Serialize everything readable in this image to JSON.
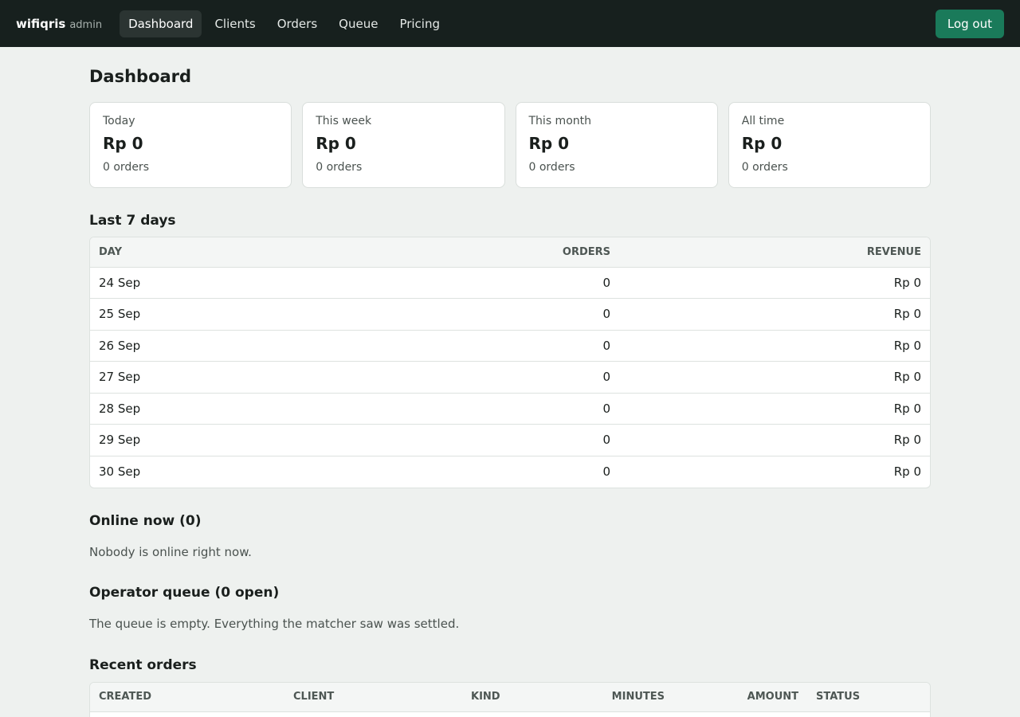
{
  "header": {
    "brand": "wifiqris",
    "role": "admin",
    "nav": [
      {
        "label": "Dashboard",
        "active": true
      },
      {
        "label": "Clients",
        "active": false
      },
      {
        "label": "Orders",
        "active": false
      },
      {
        "label": "Queue",
        "active": false
      },
      {
        "label": "Pricing",
        "active": false
      }
    ],
    "logout_label": "Log out",
    "accent_color": "#1a7a5a"
  },
  "page": {
    "title": "Dashboard"
  },
  "stats": [
    {
      "label": "Today",
      "value": "Rp 0",
      "sub": "0 orders"
    },
    {
      "label": "This week",
      "value": "Rp 0",
      "sub": "0 orders"
    },
    {
      "label": "This month",
      "value": "Rp 0",
      "sub": "0 orders"
    },
    {
      "label": "All time",
      "value": "Rp 0",
      "sub": "0 orders"
    }
  ],
  "last7": {
    "title": "Last 7 days",
    "columns": [
      "Day",
      "Orders",
      "Revenue"
    ],
    "rows": [
      {
        "day": "24 Sep",
        "orders": "0",
        "revenue": "Rp 0"
      },
      {
        "day": "25 Sep",
        "orders": "0",
        "revenue": "Rp 0"
      },
      {
        "day": "26 Sep",
        "orders": "0",
        "revenue": "Rp 0"
      },
      {
        "day": "27 Sep",
        "orders": "0",
        "revenue": "Rp 0"
      },
      {
        "day": "28 Sep",
        "orders": "0",
        "revenue": "Rp 0"
      },
      {
        "day": "29 Sep",
        "orders": "0",
        "revenue": "Rp 0"
      },
      {
        "day": "30 Sep",
        "orders": "0",
        "revenue": "Rp 0"
      }
    ]
  },
  "online": {
    "title": "Online now (0)",
    "empty": "Nobody is online right now."
  },
  "queue": {
    "title": "Operator queue (0 open)",
    "empty": "The queue is empty. Everything the matcher saw was settled."
  },
  "recent": {
    "title": "Recent orders",
    "columns": [
      "Created",
      "Client",
      "Kind",
      "Minutes",
      "Amount",
      "Status"
    ]
  }
}
